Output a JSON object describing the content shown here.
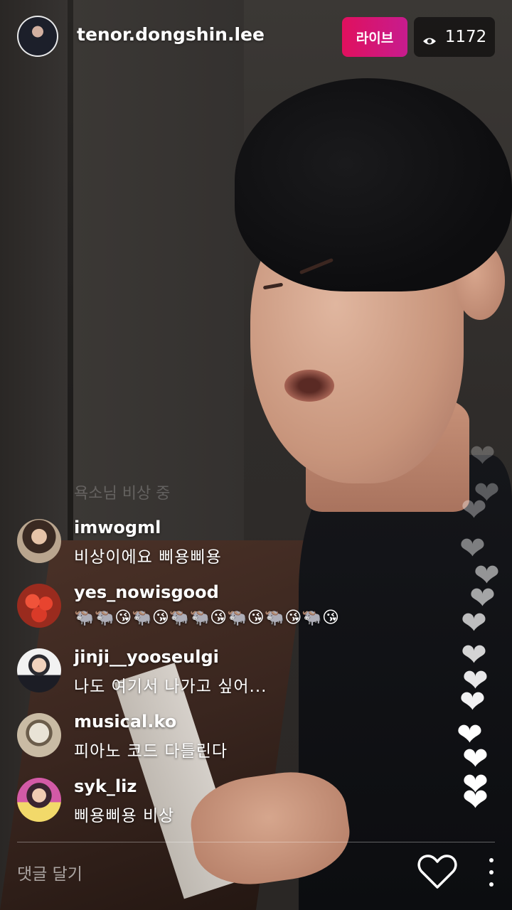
{
  "header": {
    "username": "tenor.dongshin.lee",
    "live_label": "라이브",
    "viewer_count": "1172"
  },
  "faded_comment": "욕소님 비상 중",
  "comments": [
    {
      "username": "imwogml",
      "text": "비상이에요 삐용삐용"
    },
    {
      "username": "yes_nowisgood",
      "text": "🐃🐃😘🐃😘🐃🐃😘🐃😘🐃😘🐃😘"
    },
    {
      "username": "jinji__yooseulgi",
      "text": "나도 여기서 나가고 싶어..."
    },
    {
      "username": "musical.ko",
      "text": "피아노 코드 다틀린다"
    },
    {
      "username": "syk_liz",
      "text": "삐용삐용 비상"
    }
  ],
  "footer": {
    "comment_placeholder": "댓글 달기"
  },
  "icons": {
    "viewers": "eye-icon",
    "like": "heart-outline-icon",
    "more": "more-vertical-icon"
  },
  "colors": {
    "live_badge": "#e0105e",
    "viewer_badge_bg": "#000000"
  }
}
